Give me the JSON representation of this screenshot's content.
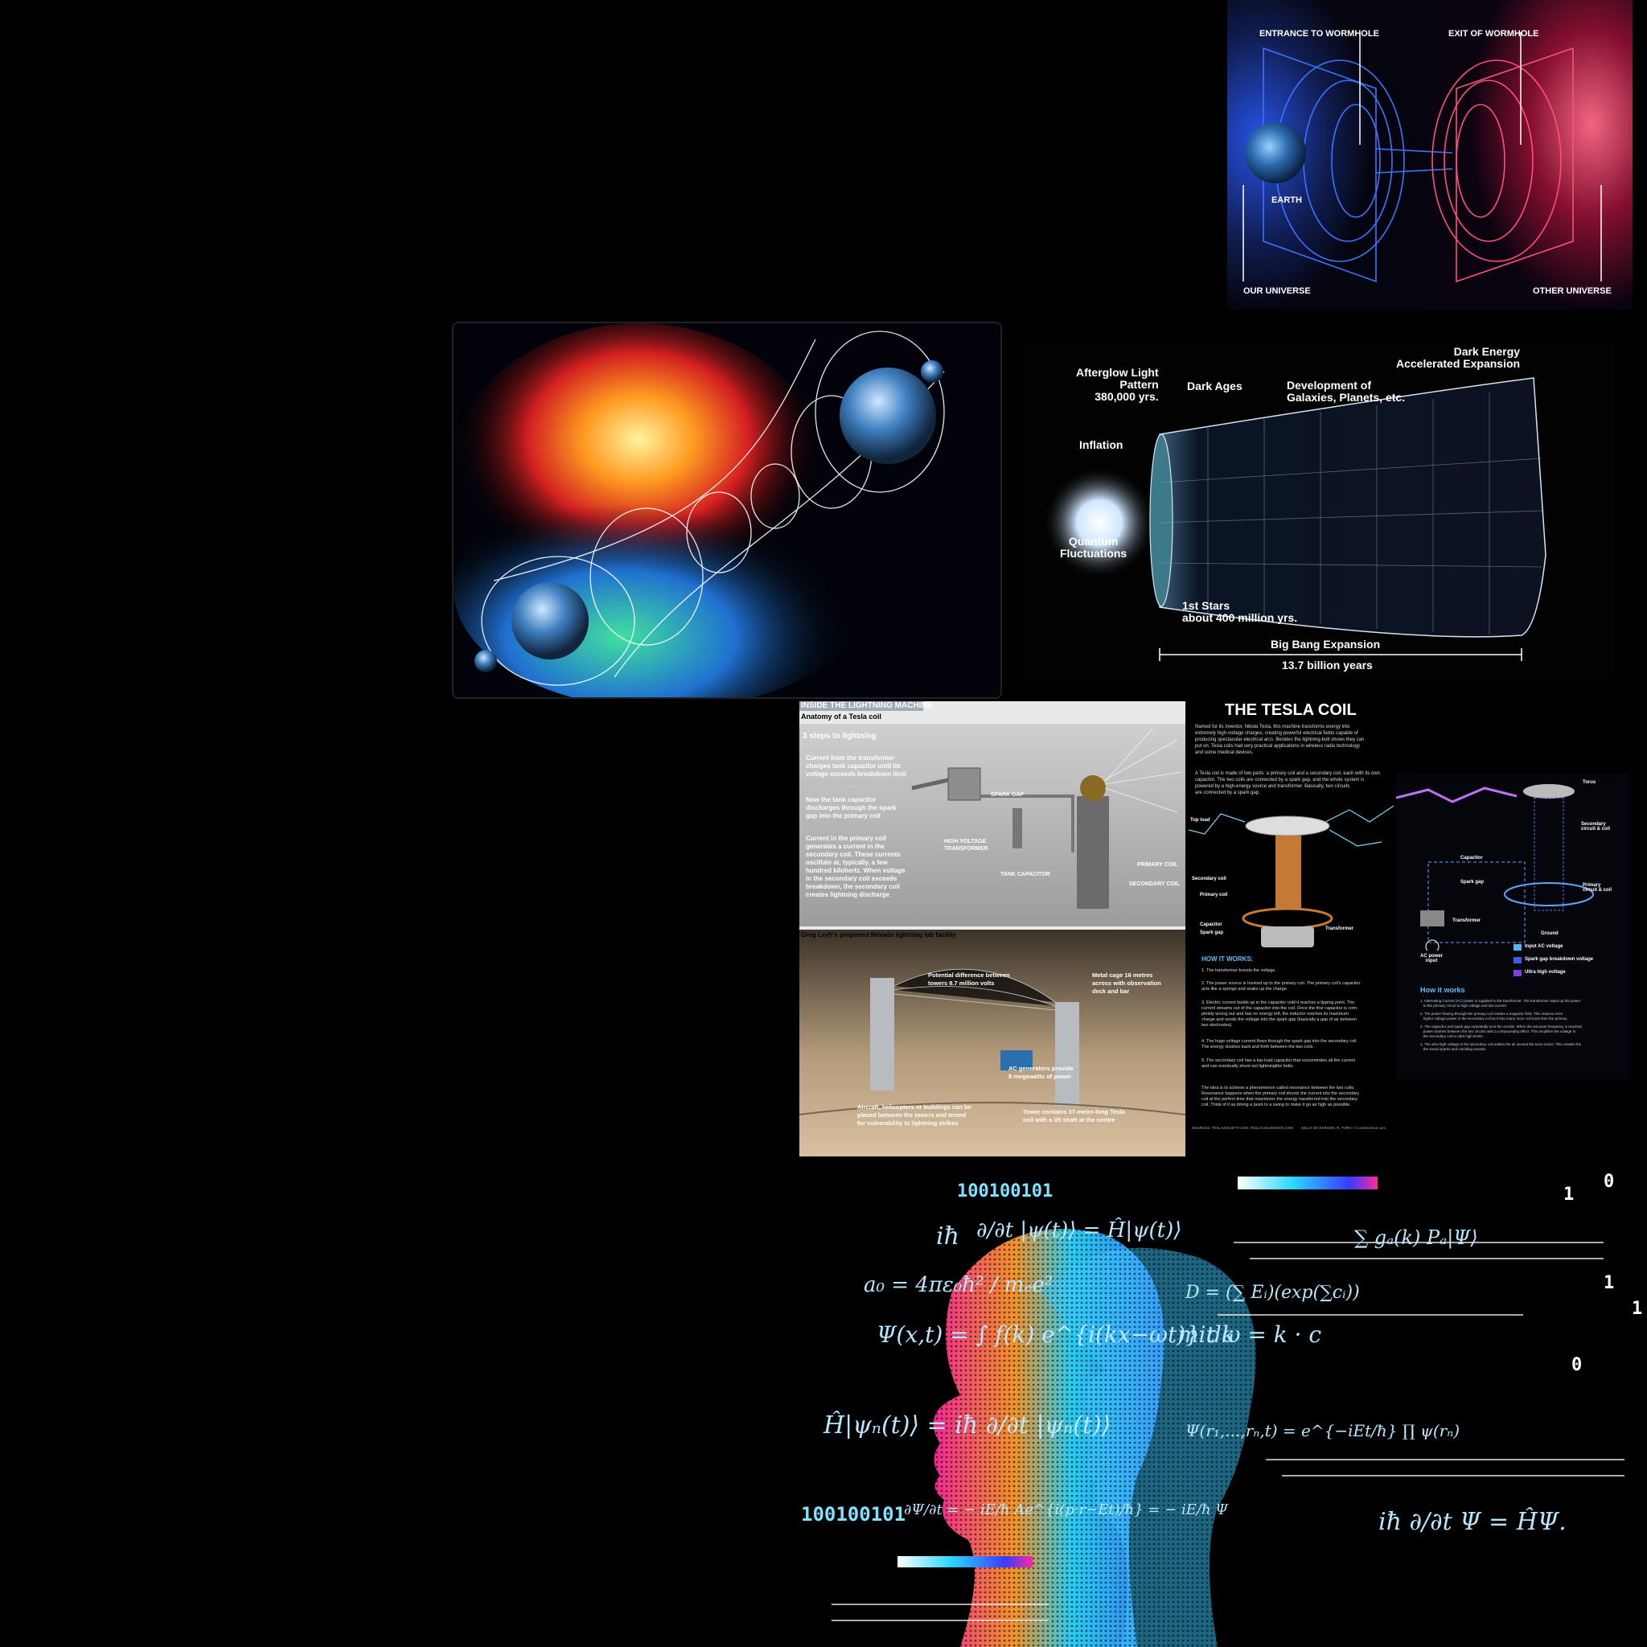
{
  "wormhole_infographic": {
    "entrance_label": "ENTRANCE TO WORMHOLE",
    "exit_label": "EXIT OF WORMHOLE",
    "earth_label": "EARTH",
    "our_universe_label": "OUR UNIVERSE",
    "other_universe_label": "OTHER UNIVERSE"
  },
  "big_bang_timeline": {
    "afterglow": "Afterglow Light\nPattern\n380,000 yrs.",
    "dark_ages": "Dark Ages",
    "development": "Development of\nGalaxies, Planets, etc.",
    "dark_energy": "Dark Energy\nAccelerated Expansion",
    "inflation": "Inflation",
    "quantum": "Quantum\nFluctuations",
    "first_stars": "1st Stars\nabout 400 million yrs.",
    "expansion": "Big Bang Expansion",
    "duration": "13.7 billion years"
  },
  "tesla_left": {
    "header": "INSIDE THE LIGHTNING MACHINE",
    "subheader": "Anatomy of a Tesla coil",
    "steps_title": "3 steps to lightning",
    "step1": "Current from the transformer\ncharges tank capacitor until its\nvoltage exceeds breakdown limit",
    "step2": "Now the tank capacitor\ndischarges through the spark\ngap into the primary coil",
    "step3": "Current in the primary coil\ngenerates a current in the\nsecondary coil. These currents\noscillate at, typically, a few\nhundred kilohertz. When voltage\nin the secondary coil exceeds\nbreakdown, the secondary coil\ncreates lightning discharge",
    "spark_gap": "SPARK GAP",
    "hv_transformer": "HIGH VOLTAGE\nTRANSFORMER",
    "tank_capacitor": "TANK CAPACITOR",
    "primary_coil": "PRIMARY COIL",
    "secondary_coil": "SECONDARY COIL",
    "lab_title": "Greg Leyh's proposed Nevada lightning lab facility",
    "lab_note1": "Potential difference between\ntowers 8.7 million volts",
    "lab_note2": "Metal cage 16 metres\nacross with observation\ndeck and bar",
    "lab_note3": "AC generators provide\n8 megawatts of power",
    "lab_note4": "Aircraft, helicopters or buildings can be\nplaced between the towers and tested\nfor vulnerability to lightning strikes",
    "lab_note5": "Tower contains 37-metre-long Tesla\ncoil with a lift shaft at the centre"
  },
  "tesla_right": {
    "title": "THE TESLA COIL",
    "intro": "Named for its inventor, Nikola Tesla, this machine transforms energy into\nextremely high-voltage charges, creating powerful electrical fields capable of\nproducing spectacular electrical arcs. Besides the lightning-bolt shows they can\nput on, Tesla coils had very practical applications in wireless radio technology\nand some medical devices.",
    "parts": "A Tesla coil is made of two parts: a primary coil and a secondary coil, each with its own\ncapacitor. The two coils are connected by a spark gap, and the whole system is\npowered by a high-energy source and transformer. Basically, two circuits\nare connected by a spark gap.",
    "top_load": "Top load",
    "secondary_coil": "Secondary coil",
    "primary_coil": "Primary coil",
    "capacitor": "Capacitor",
    "spark_gap": "Spark gap",
    "transformer": "Transformer",
    "how_title": "HOW IT WORKS:",
    "how1": "1. The transformer boosts the voltage.",
    "how2": "2. The power source is hooked up to the primary coil. The primary coil's capacitor\nacts like a sponge and soaks up the charge.",
    "how3": "3. Electric current builds up in the capacitor until it reaches a tipping point. The\ncurrent streams out of the capacitor into the coil. Once the first capacitor is com-\npletely wrung out and has no energy left, the inductor reaches its maximum\ncharge and sends the voltage into the spark gap (basically a gap of air between\ntwo electrodes).",
    "how4": "4. The huge voltage current flows through the spark gap into the secondary coil.\nThe energy sloshes back and forth between the two coils.",
    "how5": "5. The secondary coil has a top-load capacitor that concentrates all the current\nand can eventually shoot out lightninglike bolts.",
    "resonance": "The idea is to achieve a phenomenon called resonance between the two coils.\nResonance happens when the primary coil shoots the current into the secondary\ncoil at the perfect time that maximizes the energy transferred into the secondary\ncoil. Think of it as timing a push to a swing to make it go as high as possible.",
    "sources": "SOURCES: TESLASOCIETY.COM, TESLACOILDESIGN.COM",
    "credit": "KELLY DICKERSON, R. TORO / © LiveScience.com",
    "torus": "Torus",
    "secondary_circuit": "Secondary\ncircuit & coil",
    "primary_circuit": "Primary\ncircuit & coil",
    "capacitor2": "Capacitor",
    "spark_gap2": "Spark gap",
    "transformer2": "Transformer",
    "ground": "Ground",
    "ac_input": "AC power\ninput",
    "legend1": "Input AC voltage",
    "legend2": "Spark gap breakdown voltage",
    "legend3": "Ultra high voltage",
    "legend_colors": [
      "#4fb6f0",
      "#3a5fe0",
      "#7b3fe0"
    ],
    "how_works": "How it works",
    "hw1": "1. Alternating Current (AC) power is supplied to the transformer. The transformer steps up the power\n   to the primary circuit to high voltage and low current.",
    "hw2": "2. The power flowing through the primary coil creates a magnetic field. This induces even\n   higher voltage power in the secondary coil as it has many more coil turns than the primary.",
    "hw3": "3. The capacitor and spark gap repeatedly tune the circuits. When the resonant frequency is reached,\n   power sloshes between the two circuits with a compounding effect. This amplifies the voltage in\n   the secondary coil to ultra high levels.",
    "hw4": "4. The ultra high voltage in the secondary coil makes the air around the torus ionize. This creates the\n   the visual sparks and crackling sounds."
  },
  "quantum_art": {
    "bin1": "100100101",
    "eq1_a": "iħ",
    "eq1_b": "∂/∂t |ψ(t)⟩ = Ĥ|ψ(t)⟩",
    "eq2": "a₀ = 4πε₀ħ² / mₑe²",
    "eq3": "Ψ(x,t) = ∫ f(k) e^{i(kx−ωt)} dk",
    "eq4": "∑ gₐ(k) Pₐ|Ψ⟩",
    "eq5": "D = (∑ Eᵢ)(exp(∑cᵢ))",
    "eq6": "mit ω = k · c",
    "eq7": "Ĥ|ψₙ(t)⟩ = iħ ∂/∂t |ψₙ(t)⟩",
    "eq8": "Ψ(r₁,...,rₙ,t) = e^{−iEt/ħ} ∏ ψ(rₙ)",
    "eq9_bin": "100100101",
    "eq9": "∂Ψ/∂t = − iE/ħ Ae^{i(p·r−Et)/ħ} = − iE/ħ Ψ",
    "eq10": "iħ ∂/∂t Ψ = ĤΨ.",
    "num0": "0",
    "num1": "1",
    "num1b": "1",
    "num1c": "1",
    "num0b": "0"
  }
}
